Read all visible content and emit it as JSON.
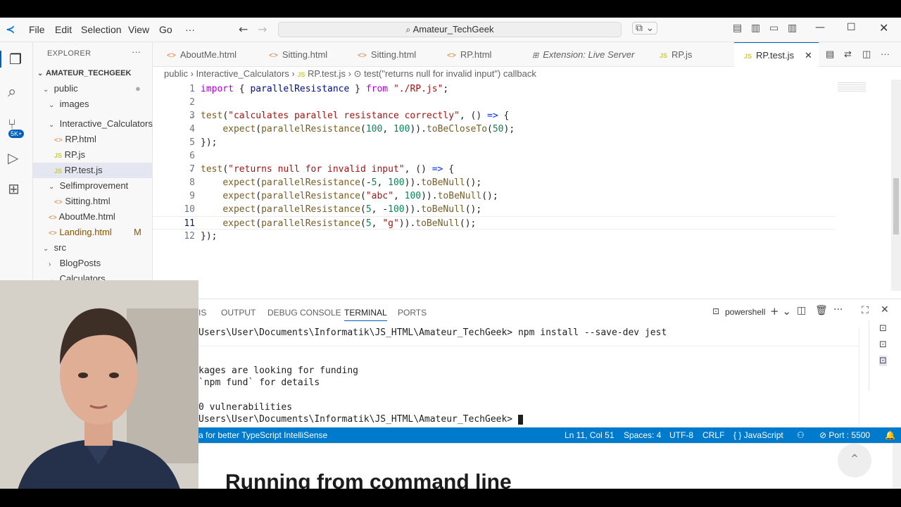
{
  "titlebar": {
    "menu": [
      "File",
      "Edit",
      "Selection",
      "View",
      "Go",
      "···"
    ],
    "search": "Amateur_TechGeek"
  },
  "sidebar": {
    "title": "EXPLORER",
    "root": "AMATEUR_TECHGEEK",
    "items": [
      {
        "label": "public",
        "chev": "⌄",
        "depth": 1
      },
      {
        "label": "images",
        "chev": "⌄",
        "depth": 2
      },
      {
        "label": "Interactive_Calculators",
        "chev": "⌄",
        "depth": 2
      },
      {
        "label": "RP.html",
        "icon": "<>",
        "depth": 3
      },
      {
        "label": "RP.js",
        "icon": "JS",
        "depth": 3
      },
      {
        "label": "RP.test.js",
        "icon": "JS",
        "depth": 3
      },
      {
        "label": "Selfimprovement",
        "chev": "⌄",
        "depth": 2
      },
      {
        "label": "Sitting.html",
        "icon": "<>",
        "depth": 3
      },
      {
        "label": "AboutMe.html",
        "icon": "<>",
        "depth": 2
      },
      {
        "label": "Landing.html",
        "icon": "<>",
        "depth": 2,
        "badge": "M"
      },
      {
        "label": "src",
        "chev": "⌄",
        "depth": 1
      },
      {
        "label": "BlogPosts",
        "chev": "›",
        "depth": 2
      },
      {
        "label": "Calculators",
        "chev": "⌄",
        "depth": 2
      }
    ],
    "activity_badge": "5K+"
  },
  "tabs": [
    {
      "label": "AboutMe.html",
      "icon": "<>"
    },
    {
      "label": "Sitting.html",
      "icon": "<>"
    },
    {
      "label": "Sitting.html",
      "icon": "<>"
    },
    {
      "label": "RP.html",
      "icon": "<>"
    },
    {
      "label": "Extension: Live Server",
      "icon": "⊞"
    },
    {
      "label": "RP.js",
      "icon": "JS"
    },
    {
      "label": "RP.test.js",
      "icon": "JS"
    }
  ],
  "breadcrumb": {
    "parts": [
      "public",
      "Interactive_Calculators",
      "RP.test.js",
      "test(\"returns null for invalid input\") callback"
    ]
  },
  "editor": {
    "current_line": 11,
    "lines": [
      "import { parallelResistance } from \"./RP.js\";",
      "",
      "test(\"calculates parallel resistance correctly\", () => {",
      "    expect(parallelResistance(100, 100)).toBeCloseTo(50);",
      "});",
      "",
      "test(\"returns null for invalid input\", () => {",
      "    expect(parallelResistance(-5, 100)).toBeNull();",
      "    expect(parallelResistance(\"abc\", 100)).toBeNull();",
      "    expect(parallelResistance(5, -100)).toBeNull();",
      "    expect(parallelResistance(5, \"g\")).toBeNull();",
      "});"
    ]
  },
  "panel": {
    "tabs": [
      "IS",
      "OUTPUT",
      "DEBUG CONSOLE",
      "TERMINAL",
      "PORTS"
    ],
    "active_tab": "TERMINAL",
    "shell": "powershell",
    "terminal_lines": [
      "Users\\User\\Documents\\Informatik\\JS_HTML\\Amateur_TechGeek> npm install --save-dev jest",
      "",
      "kages are looking for funding",
      "`npm fund` for details",
      "",
      "0 vulnerabilities",
      "Users\\User\\Documents\\Informatik\\JS_HTML\\Amateur_TechGeek> "
    ]
  },
  "statusbar": {
    "left": "a for better TypeScript IntelliSense",
    "position": "Ln 11, Col 51",
    "spaces": "Spaces: 4",
    "encoding": "UTF-8",
    "eol": "CRLF",
    "language": "{ } JavaScript",
    "port": "Port : 5500"
  },
  "browser": {
    "heading": "Running from command line"
  },
  "colors": {
    "statusbar": "#007acc",
    "accent": "#005fb8"
  }
}
